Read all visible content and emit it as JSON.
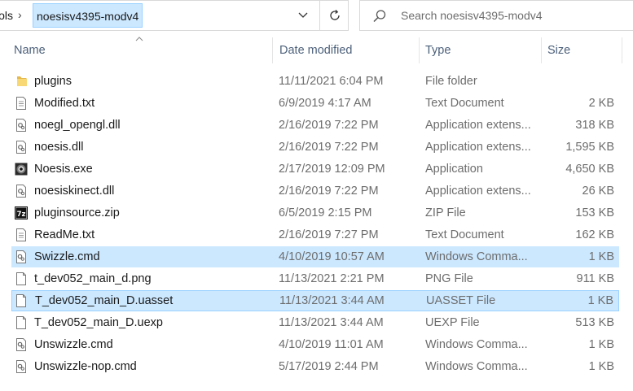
{
  "address_bar": {
    "path_prefix": "ols",
    "separator": "›",
    "current_folder": "noesisv4395-modv4",
    "dropdown_glyph": "⌄"
  },
  "search": {
    "placeholder": "Search noesisv4395-modv4"
  },
  "columns": {
    "name": "Name",
    "date": "Date modified",
    "type": "Type",
    "size": "Size"
  },
  "files": [
    {
      "name": "plugins",
      "date": "11/11/2021 6:04 PM",
      "type": "File folder",
      "size": "",
      "icon": "folder-icon",
      "state": "normal"
    },
    {
      "name": "Modified.txt",
      "date": "6/9/2019 4:17 AM",
      "type": "Text Document",
      "size": "2 KB",
      "icon": "text-file-icon",
      "state": "normal"
    },
    {
      "name": "noegl_opengl.dll",
      "date": "2/16/2019 7:22 PM",
      "type": "Application extens...",
      "size": "318 KB",
      "icon": "dll-file-icon",
      "state": "normal"
    },
    {
      "name": "noesis.dll",
      "date": "2/16/2019 7:22 PM",
      "type": "Application extens...",
      "size": "1,595 KB",
      "icon": "dll-file-icon",
      "state": "normal"
    },
    {
      "name": "Noesis.exe",
      "date": "2/17/2019 12:09 PM",
      "type": "Application",
      "size": "4,650 KB",
      "icon": "exe-app-icon",
      "state": "normal"
    },
    {
      "name": "noesiskinect.dll",
      "date": "2/16/2019 7:22 PM",
      "type": "Application extens...",
      "size": "26 KB",
      "icon": "dll-file-icon",
      "state": "normal"
    },
    {
      "name": "pluginsource.zip",
      "date": "6/5/2019 2:15 PM",
      "type": "ZIP File",
      "size": "153 KB",
      "icon": "7z-archive-icon",
      "state": "normal"
    },
    {
      "name": "ReadMe.txt",
      "date": "2/16/2019 7:27 PM",
      "type": "Text Document",
      "size": "162 KB",
      "icon": "text-file-icon",
      "state": "normal"
    },
    {
      "name": "Swizzle.cmd",
      "date": "4/10/2019 10:57 AM",
      "type": "Windows Comma...",
      "size": "1 KB",
      "icon": "cmd-file-icon",
      "state": "selected"
    },
    {
      "name": "t_dev052_main_d.png",
      "date": "11/13/2021 2:21 PM",
      "type": "PNG File",
      "size": "911 KB",
      "icon": "blank-file-icon",
      "state": "normal"
    },
    {
      "name": "T_dev052_main_D.uasset",
      "date": "11/13/2021 3:44 AM",
      "type": "UASSET File",
      "size": "1 KB",
      "icon": "blank-file-icon",
      "state": "focused"
    },
    {
      "name": "T_dev052_main_D.uexp",
      "date": "11/13/2021 3:44 AM",
      "type": "UEXP File",
      "size": "513 KB",
      "icon": "blank-file-icon",
      "state": "normal"
    },
    {
      "name": "Unswizzle.cmd",
      "date": "4/10/2019 11:01 AM",
      "type": "Windows Comma...",
      "size": "1 KB",
      "icon": "cmd-file-icon",
      "state": "normal"
    },
    {
      "name": "Unswizzle-nop.cmd",
      "date": "5/17/2019 2:44 PM",
      "type": "Windows Comma...",
      "size": "1 KB",
      "icon": "cmd-file-icon",
      "state": "normal"
    }
  ],
  "colors": {
    "selection_bg": "#cce8ff",
    "selection_border": "#99d1ff",
    "header_text": "#4c607a",
    "secondary_text": "#6d6d6d",
    "folder_yellow": "#f8d775"
  }
}
